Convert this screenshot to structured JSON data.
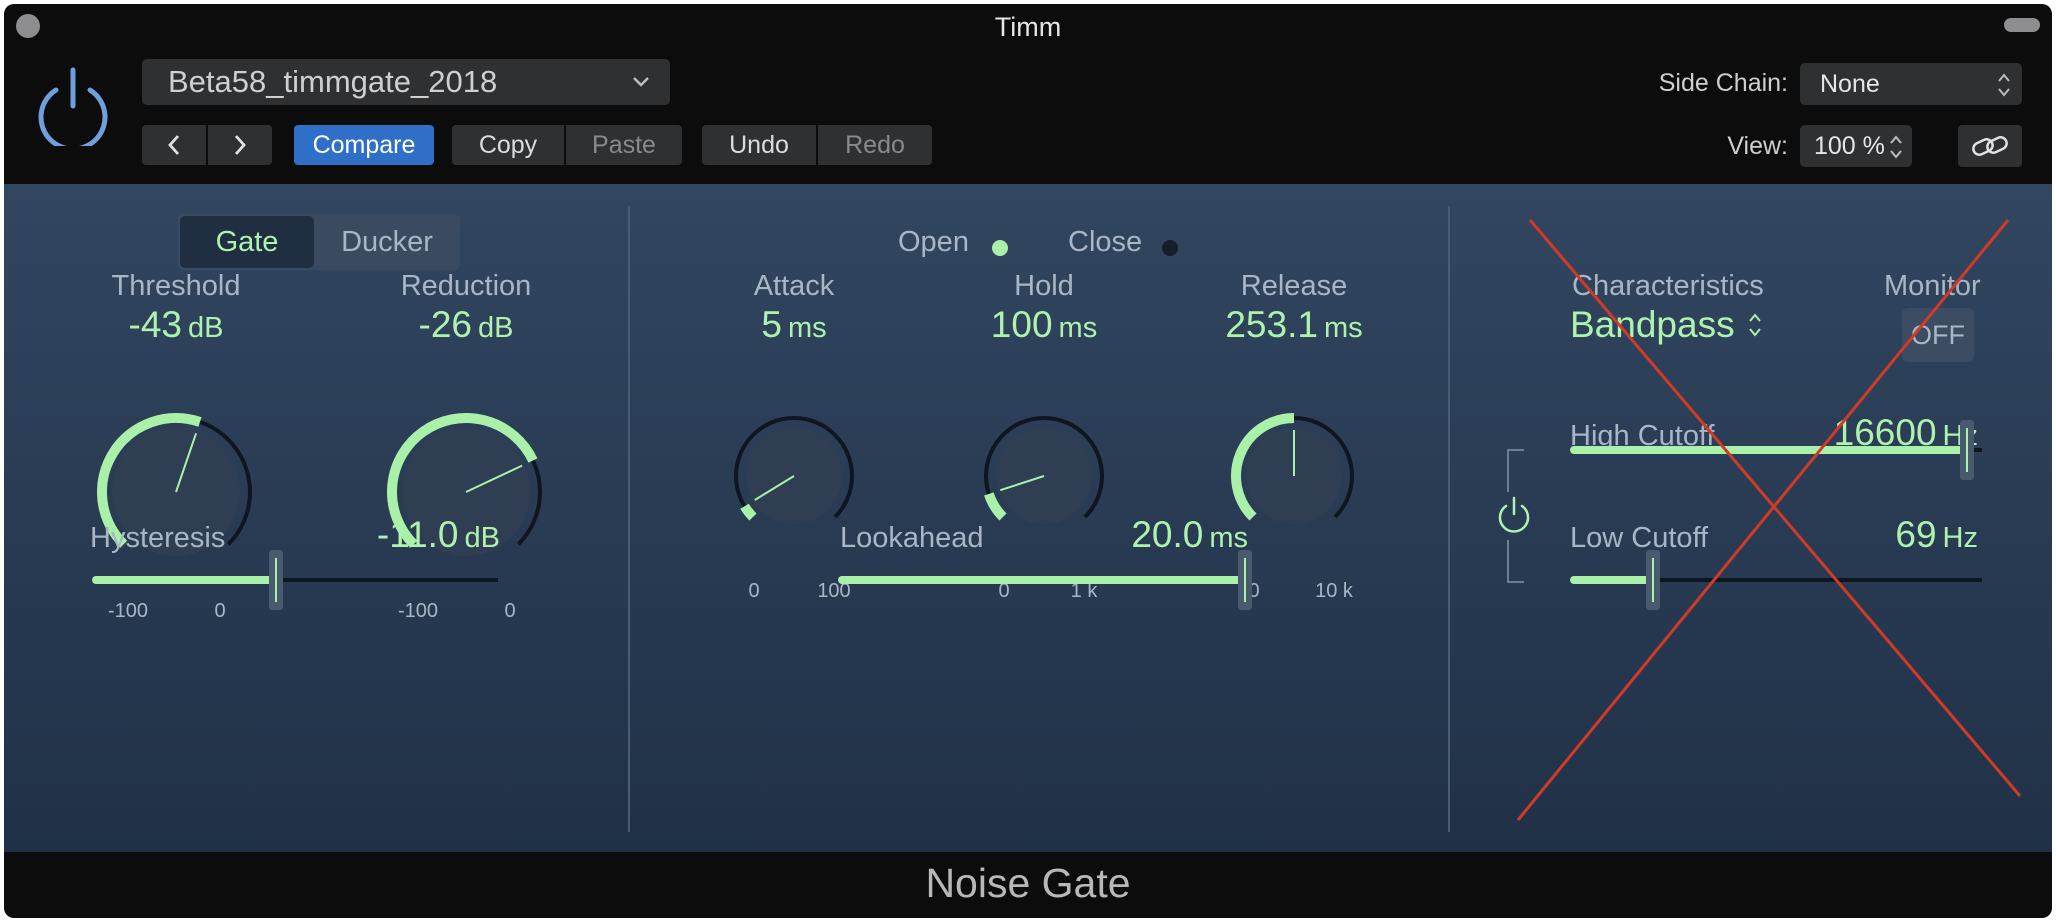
{
  "window": {
    "title": "Timm"
  },
  "header": {
    "preset": "Beta58_timmgate_2018",
    "compare_label": "Compare",
    "copy_label": "Copy",
    "paste_label": "Paste",
    "undo_label": "Undo",
    "redo_label": "Redo",
    "sidechain_label": "Side Chain:",
    "sidechain_value": "None",
    "view_label": "View:",
    "view_value": "100 %"
  },
  "mode": {
    "gate_label": "Gate",
    "ducker_label": "Ducker",
    "selected": "Gate"
  },
  "threshold": {
    "label": "Threshold",
    "value": "-43",
    "unit": "dB",
    "min": "-100",
    "max": "0",
    "fraction": 0.57
  },
  "reduction": {
    "label": "Reduction",
    "value": "-26",
    "unit": "dB",
    "min": "-100",
    "max": "0",
    "fraction": 0.74
  },
  "hysteresis": {
    "label": "Hysteresis",
    "value": "-11.0",
    "unit": "dB",
    "fraction": 0.45
  },
  "indicators": {
    "open_label": "Open",
    "close_label": "Close",
    "open_active": true,
    "close_active": false
  },
  "attack": {
    "label": "Attack",
    "value": "5",
    "unit": "ms",
    "min": "0",
    "max": "100",
    "fraction": 0.05
  },
  "hold": {
    "label": "Hold",
    "value": "100",
    "unit": "ms",
    "min": "0",
    "max": "1 k",
    "fraction": 0.1
  },
  "release": {
    "label": "Release",
    "value": "253.1",
    "unit": "ms",
    "min": "0",
    "max": "10 k",
    "fraction": 0.5
  },
  "lookahead": {
    "label": "Lookahead",
    "value": "20.0",
    "unit": "ms",
    "fraction": 1.0
  },
  "sidechain_filter": {
    "characteristics_label": "Characteristics",
    "characteristics_value": "Bandpass",
    "monitor_label": "Monitor",
    "monitor_value": "OFF",
    "high_cutoff": {
      "label": "High Cutoff",
      "value": "16600",
      "unit": "Hz",
      "fraction": 0.96
    },
    "low_cutoff": {
      "label": "Low Cutoff",
      "value": "69",
      "unit": "Hz",
      "fraction": 0.2
    }
  },
  "footer": {
    "plugin_name": "Noise Gate"
  },
  "colors": {
    "accent": "#a9f1a9",
    "compare_button": "#2f6fc7",
    "power": "#6f9fdc",
    "cross": "#d13a26",
    "panel_top": "#324660",
    "panel_bottom": "#203147"
  }
}
